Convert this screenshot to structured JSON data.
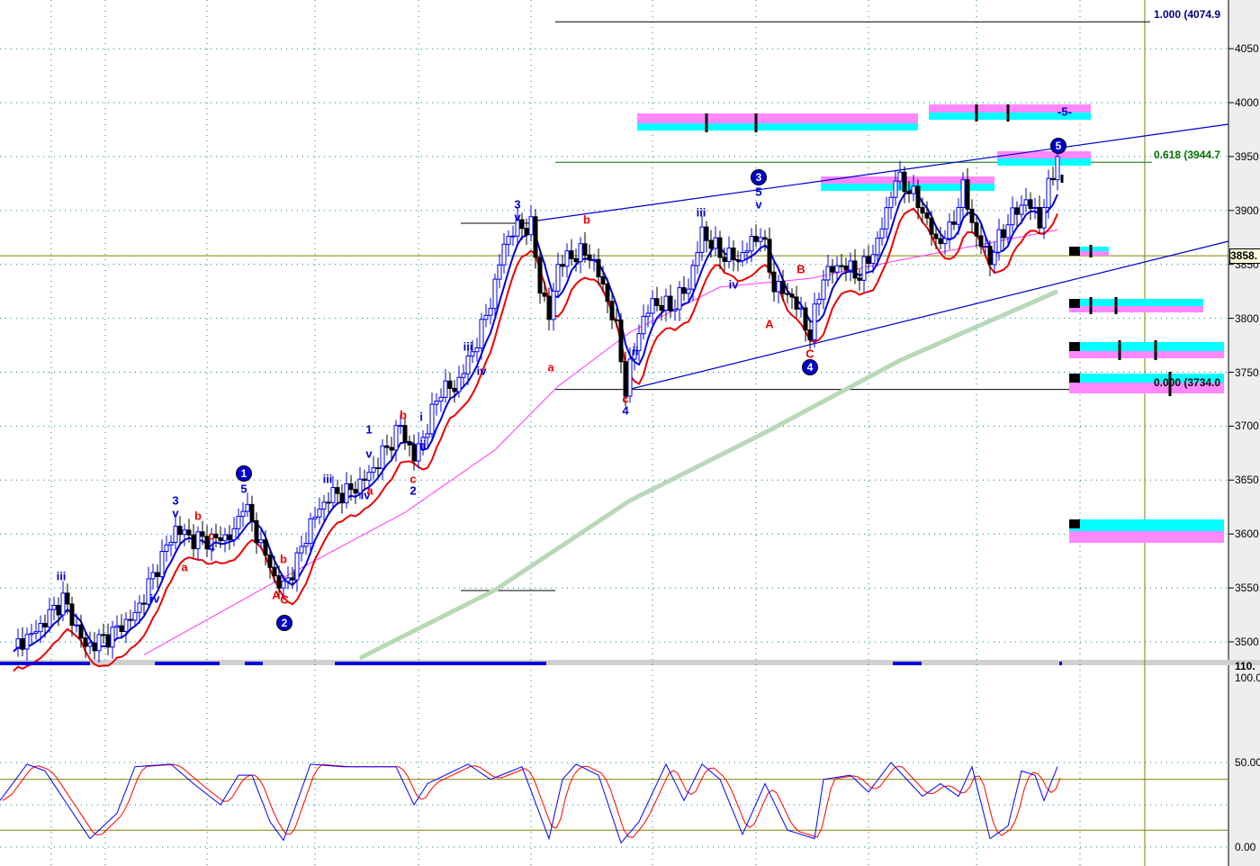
{
  "chart_data": [
    {
      "type": "candlestick",
      "title": "",
      "x_unit": "bar index",
      "ylim": [
        3480,
        4080
      ],
      "yticks": [
        "4050",
        "4000",
        "3950",
        "3900",
        "3850",
        "3800",
        "3750",
        "3700",
        "3650",
        "3600",
        "3550",
        "3500"
      ],
      "closes": [
        [
          3,
          3495
        ],
        [
          8,
          3510
        ],
        [
          14,
          3540
        ],
        [
          19,
          3495
        ],
        [
          24,
          3505
        ],
        [
          30,
          3525
        ],
        [
          35,
          3570
        ],
        [
          39,
          3605
        ],
        [
          43,
          3595
        ],
        [
          48,
          3595
        ],
        [
          52,
          3600
        ],
        [
          54,
          3630
        ],
        [
          58,
          3590
        ],
        [
          61,
          3560
        ],
        [
          63,
          3550
        ],
        [
          66,
          3575
        ],
        [
          69,
          3610
        ],
        [
          73,
          3635
        ],
        [
          78,
          3640
        ],
        [
          82,
          3655
        ],
        [
          86,
          3680
        ],
        [
          89,
          3700
        ],
        [
          92,
          3670
        ],
        [
          95,
          3700
        ],
        [
          98,
          3735
        ],
        [
          101,
          3735
        ],
        [
          104,
          3760
        ],
        [
          107,
          3790
        ],
        [
          110,
          3830
        ],
        [
          112,
          3870
        ],
        [
          115,
          3885
        ],
        [
          118,
          3885
        ],
        [
          120,
          3830
        ],
        [
          122,
          3800
        ],
        [
          124,
          3850
        ],
        [
          128,
          3860
        ],
        [
          131,
          3860
        ],
        [
          134,
          3830
        ],
        [
          137,
          3790
        ],
        [
          139,
          3735
        ],
        [
          142,
          3790
        ],
        [
          145,
          3815
        ],
        [
          149,
          3810
        ],
        [
          153,
          3830
        ],
        [
          156,
          3880
        ],
        [
          160,
          3860
        ],
        [
          164,
          3855
        ],
        [
          169,
          3880
        ],
        [
          172,
          3830
        ],
        [
          176,
          3820
        ],
        [
          180,
          3785
        ],
        [
          183,
          3840
        ],
        [
          187,
          3850
        ],
        [
          191,
          3840
        ],
        [
          195,
          3870
        ],
        [
          199,
          3930
        ],
        [
          202,
          3920
        ],
        [
          205,
          3900
        ],
        [
          208,
          3870
        ],
        [
          211,
          3880
        ],
        [
          214,
          3920
        ],
        [
          217,
          3875
        ],
        [
          220,
          3855
        ],
        [
          224,
          3890
        ],
        [
          228,
          3910
        ],
        [
          231,
          3890
        ],
        [
          233,
          3920
        ],
        [
          235,
          3950
        ]
      ],
      "ma_200": [
        [
          80,
          3485
        ],
        [
          110,
          3548
        ],
        [
          140,
          3631
        ],
        [
          170,
          3694
        ],
        [
          200,
          3761
        ],
        [
          235,
          3825
        ]
      ],
      "ma_50": [
        [
          32,
          3488
        ],
        [
          60,
          3553
        ],
        [
          90,
          3620
        ],
        [
          110,
          3678
        ],
        [
          124,
          3737
        ],
        [
          140,
          3787
        ],
        [
          160,
          3829
        ],
        [
          180,
          3837
        ],
        [
          200,
          3854
        ],
        [
          220,
          3870
        ],
        [
          235,
          3882
        ]
      ],
      "fib_levels": [
        {
          "ratio": "1.000",
          "price": 4074.9,
          "label": "1.000 (4074.9",
          "color": "#000080"
        },
        {
          "ratio": "0.618",
          "price": 3944.7,
          "label": "0.618 (3944.7",
          "color": "#007000"
        },
        {
          "ratio": "0.000",
          "price": 3734.0,
          "label": "0.000 (3734.0",
          "color": "#000000"
        }
      ],
      "current_price_label": "3858.",
      "wave_labels": [
        {
          "text": "iii",
          "color": "#0000cc"
        },
        {
          "text": "3",
          "color": "#0000cc"
        },
        {
          "text": "v",
          "color": "#0000cc"
        },
        {
          "text": "b",
          "color": "#ee0000"
        },
        {
          "text": "a",
          "color": "#ee0000"
        },
        {
          "text": "c",
          "color": "#ee0000"
        },
        {
          "text": "4",
          "color": "#0000cc"
        },
        {
          "text": "iv",
          "color": "#0000cc"
        },
        {
          "text": "1",
          "color": "#0000cc",
          "circled": true
        },
        {
          "text": "5",
          "color": "#0000cc"
        },
        {
          "text": "A",
          "color": "#ee0000"
        },
        {
          "text": "C",
          "color": "#ee0000"
        },
        {
          "text": "b",
          "color": "#ee0000"
        },
        {
          "text": "i",
          "color": "#0000cc"
        },
        {
          "text": "2",
          "color": "#0000cc",
          "circled": true
        },
        {
          "text": "iii",
          "color": "#0000cc"
        },
        {
          "text": "iv",
          "color": "#0000cc"
        },
        {
          "text": "a",
          "color": "#ee0000"
        },
        {
          "text": "v",
          "color": "#0000cc"
        },
        {
          "text": "1",
          "color": "#0000cc"
        },
        {
          "text": "b",
          "color": "#ee0000"
        },
        {
          "text": "i",
          "color": "#0000cc"
        },
        {
          "text": "ii",
          "color": "#0000cc"
        },
        {
          "text": "c",
          "color": "#ee0000"
        },
        {
          "text": "2",
          "color": "#0000cc"
        },
        {
          "text": "iii",
          "color": "#0000cc"
        },
        {
          "text": "iv",
          "color": "#0000cc"
        },
        {
          "text": "3",
          "color": "#0000cc"
        },
        {
          "text": "v",
          "color": "#0000cc"
        },
        {
          "text": "b",
          "color": "#ee0000"
        },
        {
          "text": "a",
          "color": "#ee0000"
        },
        {
          "text": "c",
          "color": "#ee0000"
        },
        {
          "text": "4",
          "color": "#0000cc"
        },
        {
          "text": "ii",
          "color": "#0000cc"
        },
        {
          "text": "iii",
          "color": "#0000cc"
        },
        {
          "text": "iv",
          "color": "#0000cc"
        },
        {
          "text": "3",
          "color": "#0000cc",
          "circled": true
        },
        {
          "text": "5",
          "color": "#0000cc"
        },
        {
          "text": "v",
          "color": "#0000cc"
        },
        {
          "text": "A",
          "color": "#ee0000"
        },
        {
          "text": "B",
          "color": "#ee0000"
        },
        {
          "text": "C",
          "color": "#ee0000"
        },
        {
          "text": "4",
          "color": "#0000cc",
          "circled": true
        },
        {
          "text": "5",
          "color": "#0000cc",
          "circled": true
        },
        {
          "text": "-5-",
          "color": "#0000cc"
        }
      ]
    },
    {
      "type": "line",
      "title": "Stochastic",
      "ylim": [
        0,
        110
      ],
      "yticks": [
        "100.0",
        "50.00",
        "0.00"
      ],
      "axis_top_label": "110.",
      "reference_levels": [
        80,
        20
      ],
      "series": [
        {
          "name": "%K",
          "color": "#0000ff"
        },
        {
          "name": "%D",
          "color": "#ff0000"
        }
      ],
      "k": [
        [
          0,
          55
        ],
        [
          6,
          98
        ],
        [
          10,
          90
        ],
        [
          15,
          50
        ],
        [
          20,
          10
        ],
        [
          26,
          40
        ],
        [
          30,
          95
        ],
        [
          38,
          98
        ],
        [
          43,
          75
        ],
        [
          49,
          50
        ],
        [
          53,
          85
        ],
        [
          56,
          85
        ],
        [
          60,
          30
        ],
        [
          63,
          8
        ],
        [
          69,
          98
        ],
        [
          76,
          95
        ],
        [
          88,
          95
        ],
        [
          92,
          50
        ],
        [
          95,
          75
        ],
        [
          104,
          98
        ],
        [
          109,
          80
        ],
        [
          116,
          95
        ],
        [
          122,
          10
        ],
        [
          125,
          80
        ],
        [
          128,
          98
        ],
        [
          133,
          85
        ],
        [
          138,
          5
        ],
        [
          142,
          30
        ],
        [
          148,
          98
        ],
        [
          152,
          55
        ],
        [
          156,
          98
        ],
        [
          160,
          80
        ],
        [
          165,
          15
        ],
        [
          170,
          75
        ],
        [
          175,
          20
        ],
        [
          181,
          10
        ],
        [
          183,
          80
        ],
        [
          189,
          85
        ],
        [
          193,
          65
        ],
        [
          198,
          100
        ],
        [
          205,
          60
        ],
        [
          209,
          75
        ],
        [
          213,
          60
        ],
        [
          216,
          95
        ],
        [
          220,
          10
        ],
        [
          224,
          25
        ],
        [
          227,
          90
        ],
        [
          230,
          85
        ],
        [
          232,
          55
        ],
        [
          235,
          95
        ]
      ]
    }
  ],
  "colors": {
    "upper_band": "#0000dd",
    "lower_band": "#ee0000",
    "ma50": "#ff33ff",
    "ma200": "#b8d8b8",
    "cyan": "#00ffff",
    "magenta": "#ff88ff",
    "trend": "#0000cc"
  }
}
